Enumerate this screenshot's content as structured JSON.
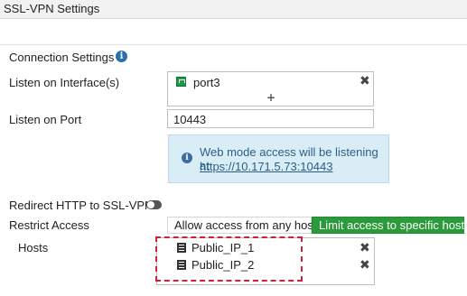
{
  "window": {
    "title": "SSL-VPN Settings"
  },
  "connection": {
    "section_title": "Connection Settings",
    "info_icon": "info-circle-icon",
    "listen_interface_label": "Listen on Interface(s)",
    "interfaces": [
      {
        "name": "port3",
        "icon": "network-port-icon"
      }
    ],
    "add_symbol": "+",
    "remove_symbol": "✖",
    "listen_port_label": "Listen on Port",
    "listen_port_value": "10443",
    "notice": {
      "icon": "info-circle-icon",
      "text": "Web mode access will be listening at",
      "url": "https://10.171.5.73:10443"
    },
    "redirect_label": "Redirect HTTP to SSL-VPN",
    "redirect_enabled": false,
    "restrict_label": "Restrict Access",
    "restrict_options": [
      {
        "label": "Allow access from any host",
        "selected": false
      },
      {
        "label": "Limit access to specific hosts",
        "selected": true
      }
    ],
    "hosts_label": "Hosts",
    "hosts": [
      {
        "name": "Public_IP_1",
        "icon": "address-icon"
      },
      {
        "name": "Public_IP_2",
        "icon": "address-icon"
      }
    ]
  },
  "colors": {
    "accent_green": "#2a9a3a",
    "notice_bg": "#d9edf7",
    "highlight_red": "#d0203a"
  }
}
